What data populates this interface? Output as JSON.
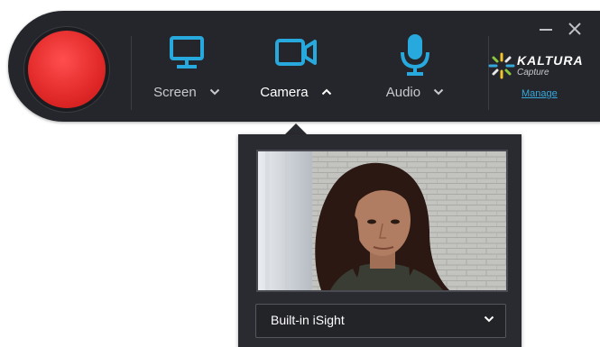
{
  "toolbar": {
    "sources": [
      {
        "label": "Screen",
        "icon": "monitor-icon"
      },
      {
        "label": "Camera",
        "icon": "video-camera-icon"
      },
      {
        "label": "Audio",
        "icon": "microphone-icon"
      }
    ],
    "window_controls": {
      "minimize_icon": "minimize-icon",
      "close_icon": "close-icon"
    },
    "logo": {
      "brand": "KALTURA",
      "product": "Capture"
    },
    "manage_link": "Manage"
  },
  "camera_panel": {
    "selected_device": "Built-in iSight"
  },
  "colors": {
    "toolbar_bg": "#25262b",
    "record_red": "#e32b2b",
    "accent_blue": "#35a8dc",
    "panel_bg": "#2a2b30"
  }
}
